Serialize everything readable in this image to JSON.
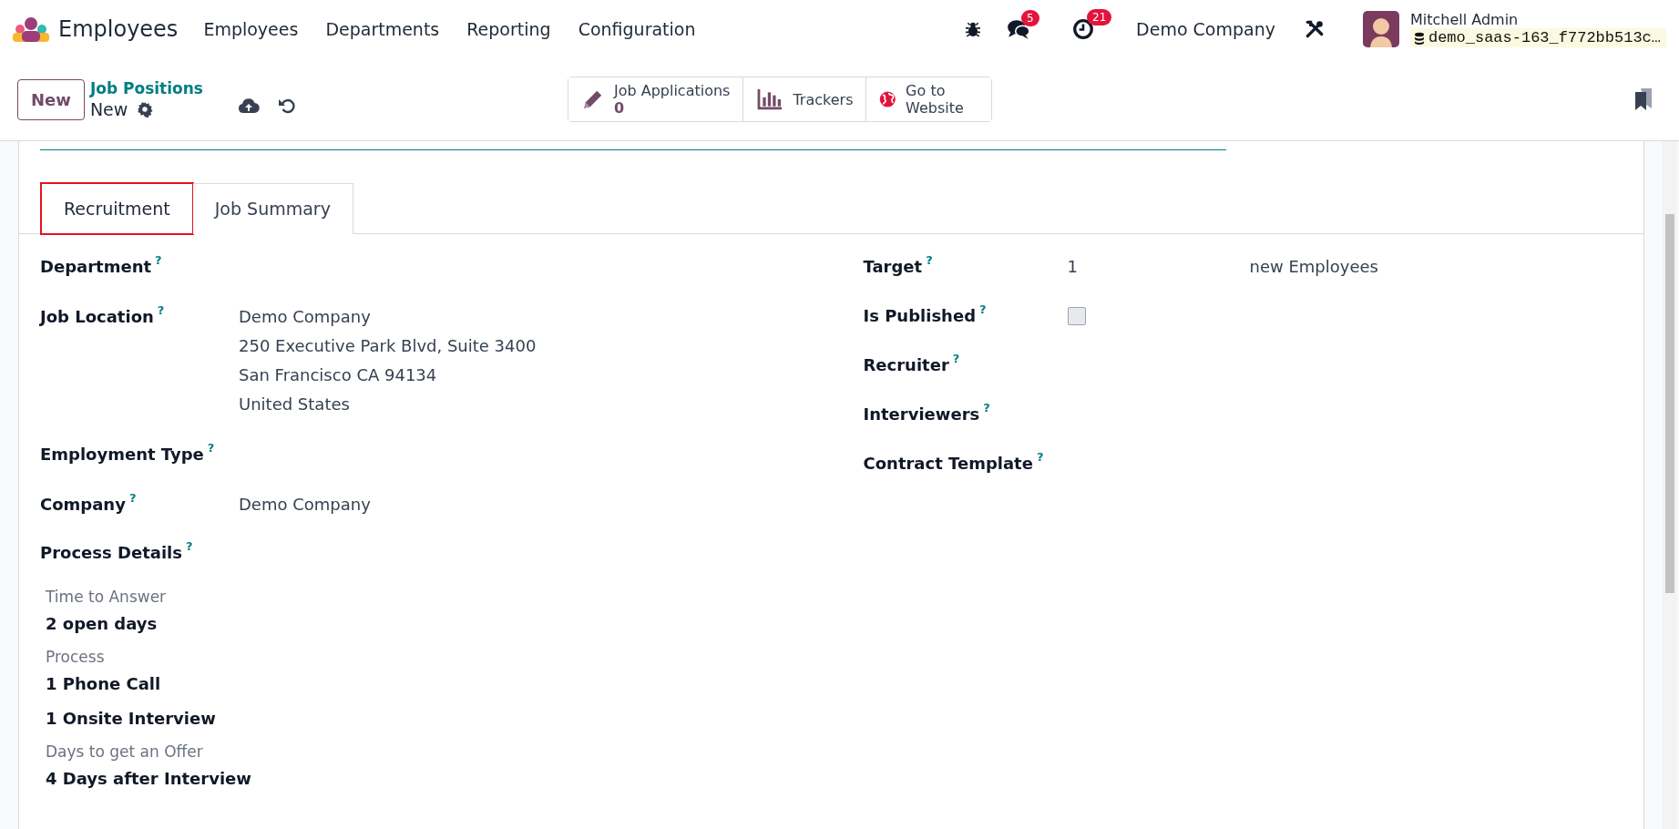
{
  "navbar": {
    "app_name": "Employees",
    "menu": [
      "Employees",
      "Departments",
      "Reporting",
      "Configuration"
    ],
    "messages_count": "5",
    "activities_count": "21",
    "company": "Demo Company",
    "user": {
      "name": "Mitchell Admin",
      "database": "demo_saas-163_f772bb513c…"
    }
  },
  "control_panel": {
    "new_button": "New",
    "breadcrumb": "Job Positions",
    "record": "New",
    "smart_buttons": [
      {
        "kind": "stat",
        "label": "Job Applications",
        "value": "0"
      },
      {
        "kind": "chart",
        "label": "Trackers"
      },
      {
        "kind": "globe",
        "label": "Go to Website"
      }
    ]
  },
  "tabs": [
    {
      "label": "Recruitment",
      "selected": true,
      "highlighted": true
    },
    {
      "label": "Job Summary",
      "selected": false,
      "highlighted": false
    }
  ],
  "left_fields": [
    {
      "label": "Department",
      "help": "?"
    },
    {
      "label": "Job Location",
      "help": "?",
      "lines": [
        "Demo Company",
        "250 Executive Park Blvd, Suite 3400",
        "San Francisco CA 94134",
        "United States"
      ]
    },
    {
      "label": "Employment Type",
      "help": "?"
    },
    {
      "label": "Company",
      "help": "?",
      "lines": [
        "Demo Company"
      ]
    }
  ],
  "process_details": {
    "label": "Process Details",
    "help": "?",
    "groups": [
      {
        "title": "Time to Answer",
        "items": [
          "2 open days"
        ]
      },
      {
        "title": "Process",
        "items": [
          "1 Phone Call",
          "1 Onsite Interview"
        ]
      },
      {
        "title": "Days to get an Offer",
        "items": [
          "4 Days after Interview"
        ]
      }
    ]
  },
  "right_fields": [
    {
      "kind": "number",
      "label": "Target",
      "help": "?",
      "value": "1",
      "suffix": "new Employees"
    },
    {
      "kind": "checkbox",
      "label": "Is Published",
      "help": "?",
      "checked": false
    },
    {
      "kind": "empty",
      "label": "Recruiter",
      "help": "?"
    },
    {
      "kind": "empty",
      "label": "Interviewers",
      "help": "?"
    },
    {
      "kind": "empty",
      "label": "Contract Template",
      "help": "?"
    }
  ]
}
